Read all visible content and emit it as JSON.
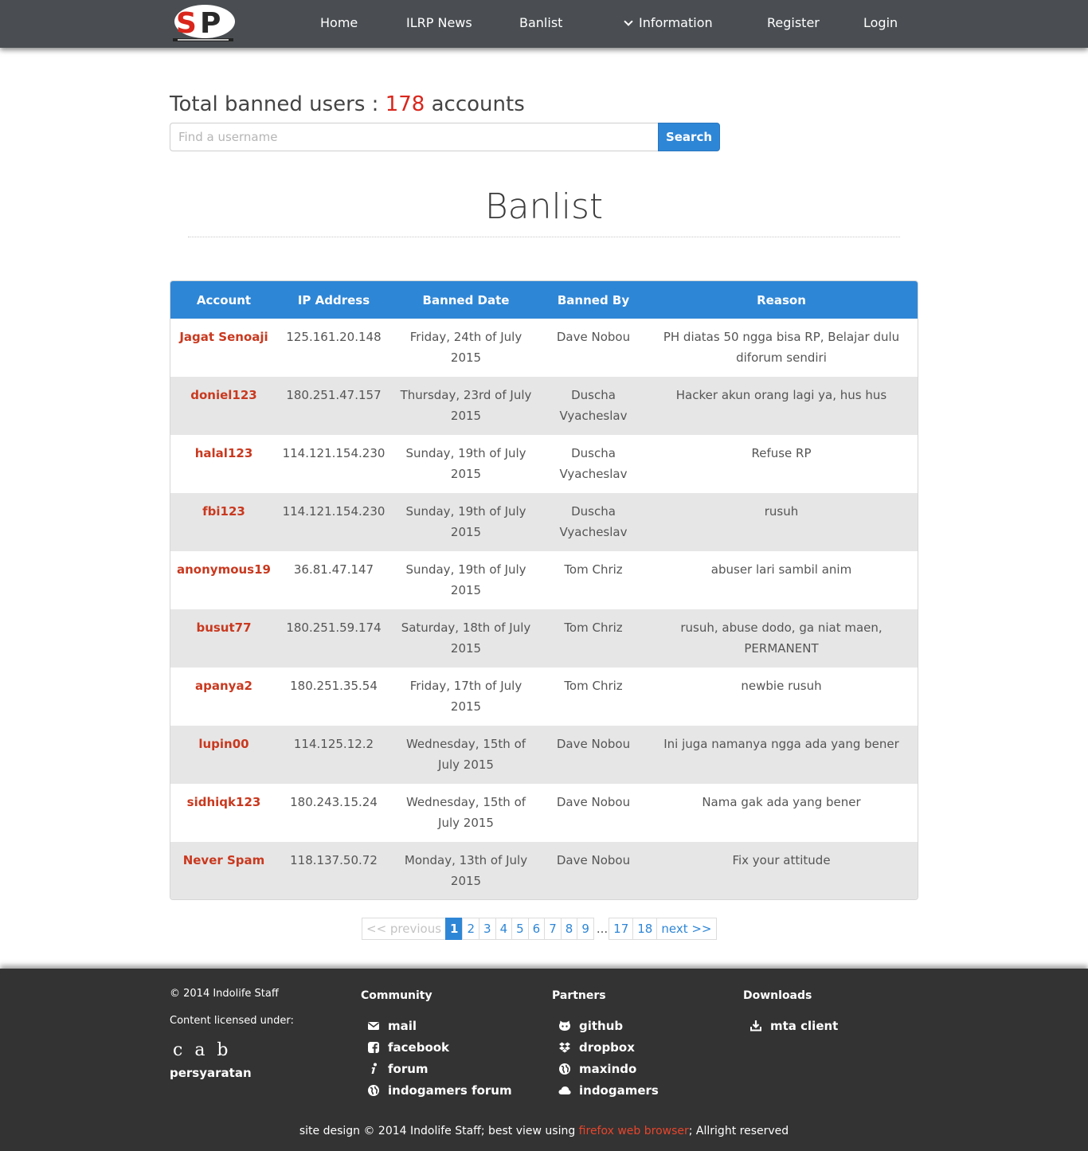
{
  "nav": {
    "logo_alt": "SP",
    "items": [
      "Home",
      "ILRP News",
      "Banlist",
      "Information",
      "Register",
      "Login"
    ]
  },
  "summary": {
    "prefix": "Total banned users : ",
    "count": "178",
    "suffix": " accounts"
  },
  "search": {
    "placeholder": "Find a username",
    "button": "Search"
  },
  "page_title": "Banlist",
  "table": {
    "columns": [
      "Account",
      "IP Address",
      "Banned Date",
      "Banned By",
      "Reason"
    ],
    "rows": [
      {
        "account": "Jagat Senoaji",
        "ip": "125.161.20.148",
        "date": "Friday, 24th of July 2015",
        "by": "Dave Nobou",
        "reason": "PH diatas 50 ngga bisa RP, Belajar dulu diforum sendiri"
      },
      {
        "account": "doniel123",
        "ip": "180.251.47.157",
        "date": "Thursday, 23rd of July 2015",
        "by": "Duscha Vyacheslav",
        "reason": "Hacker akun orang lagi ya, hus hus"
      },
      {
        "account": "halal123",
        "ip": "114.121.154.230",
        "date": "Sunday, 19th of July 2015",
        "by": "Duscha Vyacheslav",
        "reason": "Refuse RP"
      },
      {
        "account": "fbi123",
        "ip": "114.121.154.230",
        "date": "Sunday, 19th of July 2015",
        "by": "Duscha Vyacheslav",
        "reason": "rusuh"
      },
      {
        "account": "anonymous19",
        "ip": "36.81.47.147",
        "date": "Sunday, 19th of July 2015",
        "by": "Tom Chriz",
        "reason": "abuser lari sambil anim"
      },
      {
        "account": "busut77",
        "ip": "180.251.59.174",
        "date": "Saturday, 18th of July 2015",
        "by": "Tom Chriz",
        "reason": "rusuh, abuse dodo, ga niat maen, PERMANENT"
      },
      {
        "account": "apanya2",
        "ip": "180.251.35.54",
        "date": "Friday, 17th of July 2015",
        "by": "Tom Chriz",
        "reason": "newbie rusuh"
      },
      {
        "account": "lupin00",
        "ip": "114.125.12.2",
        "date": "Wednesday, 15th of July 2015",
        "by": "Dave Nobou",
        "reason": "Ini juga namanya ngga ada yang bener"
      },
      {
        "account": "sidhiqk123",
        "ip": "180.243.15.24",
        "date": "Wednesday, 15th of July 2015",
        "by": "Dave Nobou",
        "reason": "Nama gak ada yang bener"
      },
      {
        "account": "Never Spam",
        "ip": "118.137.50.72",
        "date": "Monday, 13th of July 2015",
        "by": "Dave Nobou",
        "reason": "Fix your attitude"
      }
    ]
  },
  "pagination": {
    "previous": "<< previous",
    "pages": [
      "1",
      "2",
      "3",
      "4",
      "5",
      "6",
      "7",
      "8",
      "9"
    ],
    "ellipsis": "...",
    "tail_pages": [
      "17",
      "18"
    ],
    "next": "next >>",
    "current": "1"
  },
  "footer": {
    "copyright": "© 2014 Indolife Staff",
    "license_label": "Content licensed under:",
    "cc_icons": "c a b",
    "terms": "persyaratan",
    "community": {
      "heading": "Community",
      "links": [
        {
          "label": "mail",
          "icon": "mail-icon"
        },
        {
          "label": "facebook",
          "icon": "facebook-icon"
        },
        {
          "label": "forum",
          "icon": "info-icon"
        },
        {
          "label": "indogamers forum",
          "icon": "globe-icon"
        }
      ]
    },
    "partners": {
      "heading": "Partners",
      "links": [
        {
          "label": "github",
          "icon": "github-icon"
        },
        {
          "label": "dropbox",
          "icon": "dropbox-icon"
        },
        {
          "label": "maxindo",
          "icon": "globe-icon"
        },
        {
          "label": "indogamers",
          "icon": "cloud-icon"
        }
      ]
    },
    "downloads": {
      "heading": "Downloads",
      "links": [
        {
          "label": "mta client",
          "icon": "download-icon"
        }
      ]
    },
    "credits": {
      "before": "site design © 2014 Indolife Staff; best view using ",
      "link": "firefox web browser",
      "after": "; Allright reserved"
    }
  },
  "colors": {
    "navbar": "#4a4e52",
    "accent_blue": "#2e86d6",
    "account_red": "#c9391f",
    "count_red": "#d9261c",
    "footer": "#333333",
    "row_alt": "#e6e6e6"
  }
}
